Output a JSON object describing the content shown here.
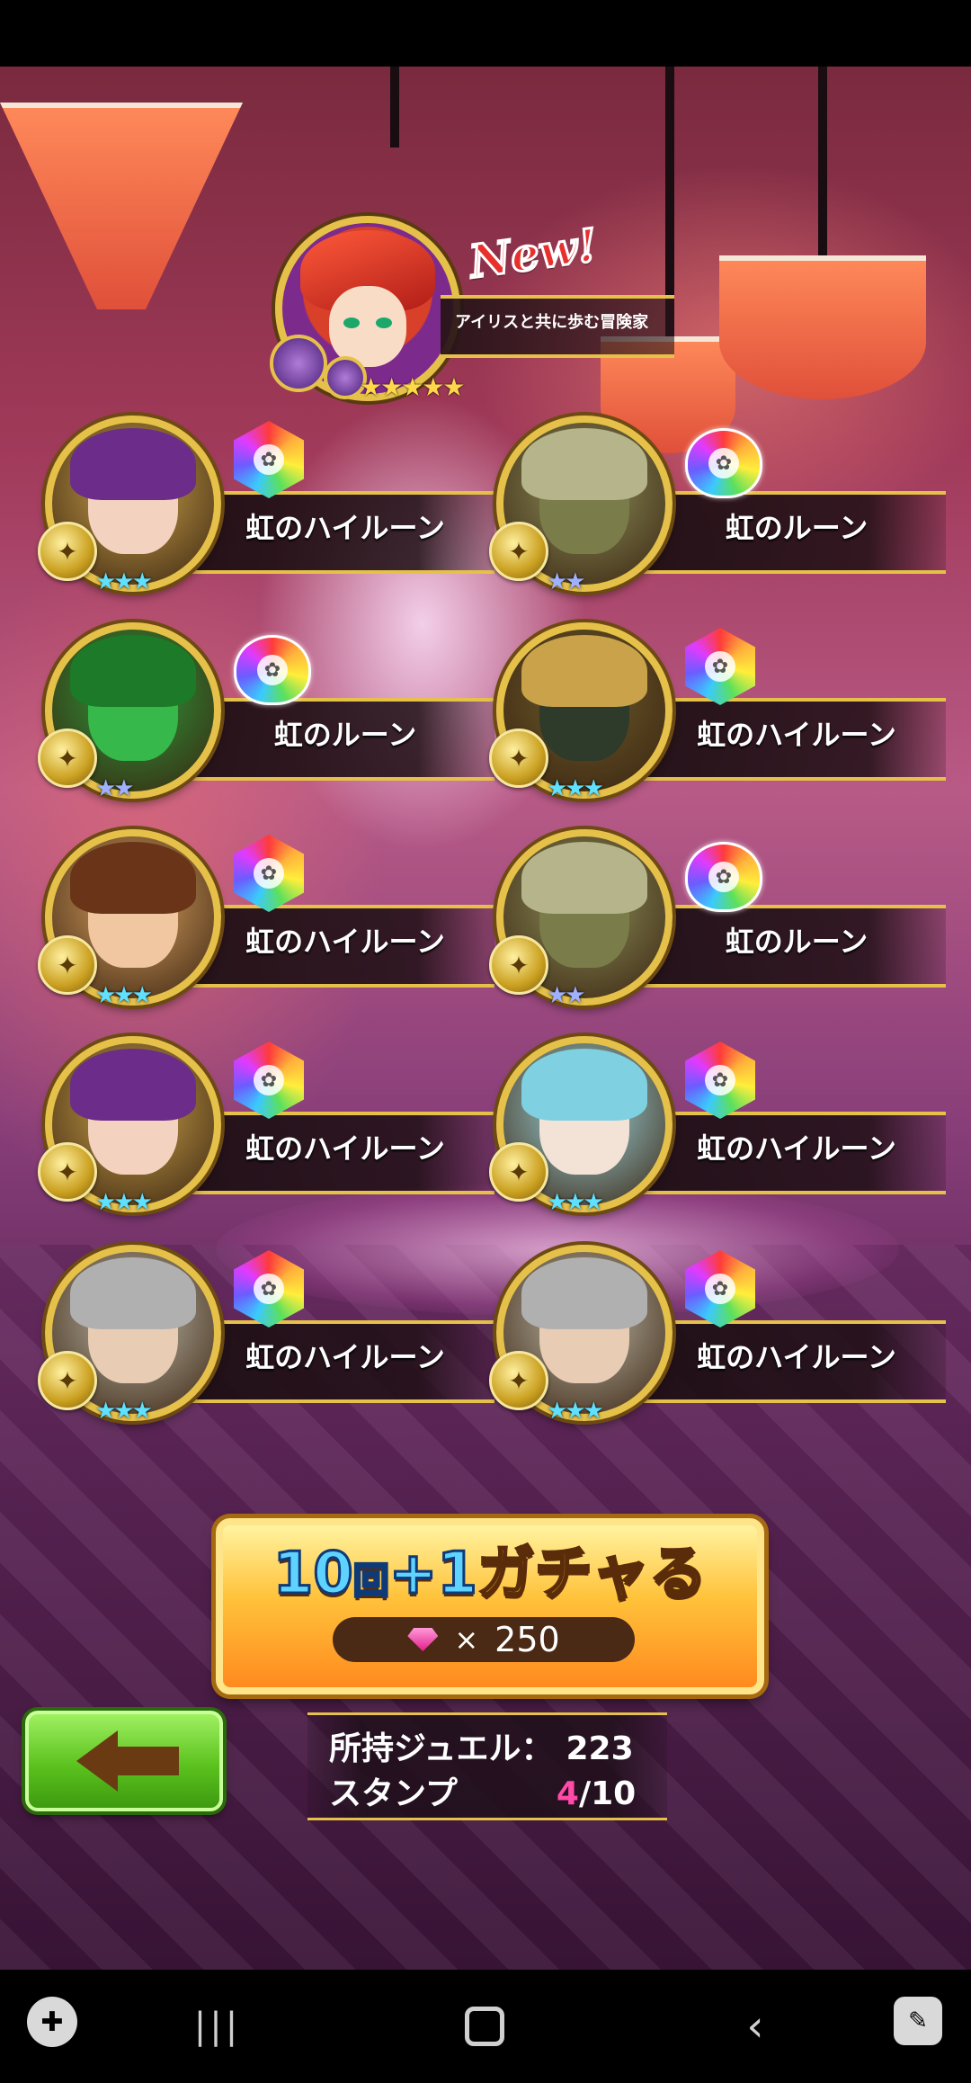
{
  "featured": {
    "badge_text": "New!",
    "name": "アイリスと共に歩む冒険家",
    "stars": "★★★★★"
  },
  "results": [
    {
      "name": "虹のハイルーン",
      "stars": "★★★",
      "rune": "hex"
    },
    {
      "name": "虹のルーン",
      "stars": "★★",
      "rune": "drop"
    },
    {
      "name": "虹のルーン",
      "stars": "★★",
      "rune": "drop"
    },
    {
      "name": "虹のハイルーン",
      "stars": "★★★",
      "rune": "hex"
    },
    {
      "name": "虹のハイルーン",
      "stars": "★★★",
      "rune": "hex"
    },
    {
      "name": "虹のルーン",
      "stars": "★★",
      "rune": "drop"
    },
    {
      "name": "虹のハイルーン",
      "stars": "★★★",
      "rune": "hex"
    },
    {
      "name": "虹のハイルーン",
      "stars": "★★★",
      "rune": "hex"
    },
    {
      "name": "虹のハイルーン",
      "stars": "★★★",
      "rune": "hex"
    },
    {
      "name": "虹のハイルーン",
      "stars": "★★★",
      "rune": "hex"
    }
  ],
  "gacha_button": {
    "title_num1": "10",
    "title_kai": "回",
    "title_plus": "+",
    "title_num2": "1",
    "title_text": "ガチャる",
    "cost_times": "×",
    "cost_value": "250"
  },
  "info": {
    "jewel_label": "所持ジュエル：",
    "jewel_value": "223",
    "stamp_label": "スタンプ",
    "stamp_current": "4",
    "stamp_total": "/10"
  },
  "colors": {
    "gold_frame": "#e5c14a",
    "stamp_highlight": "#ff4aa8",
    "back_button": "#5bc21e"
  },
  "nav": {
    "gamepad": "gamepad-icon",
    "recents": "recents-icon",
    "home": "home-icon",
    "back": "back-icon",
    "screenshot": "screenshot-icon"
  }
}
